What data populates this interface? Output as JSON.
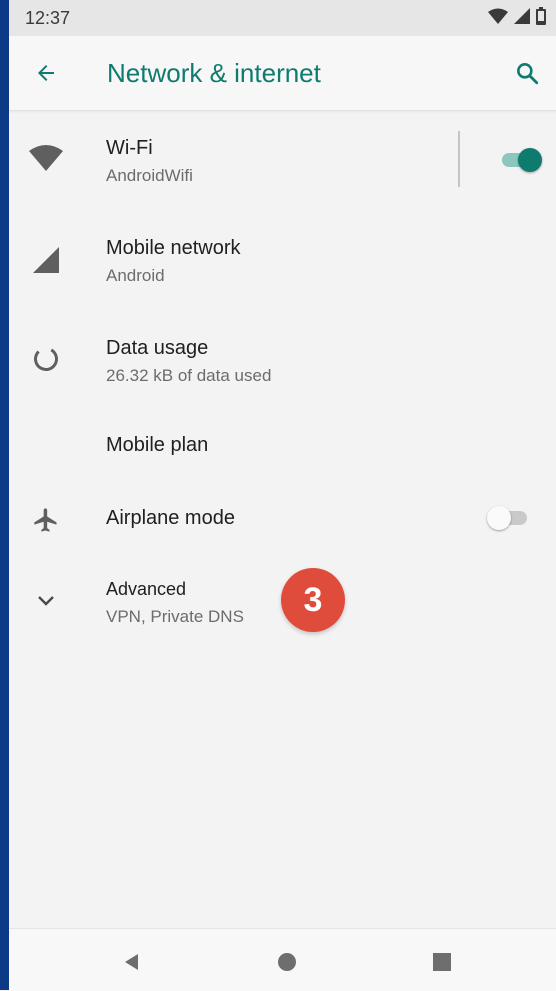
{
  "status_bar": {
    "time": "12:37",
    "icons": [
      "wifi-icon",
      "signal-icon",
      "battery-icon"
    ]
  },
  "app_bar": {
    "title": "Network & internet",
    "back_icon": "arrow-back-icon",
    "search_icon": "search-icon"
  },
  "colors": {
    "accent": "#0f7b6f",
    "badge": "#e04c3c",
    "left_stripe": "#0c3a86"
  },
  "settings": [
    {
      "icon": "wifi-icon",
      "title": "Wi-Fi",
      "subtitle": "AndroidWifi",
      "toggle": true,
      "toggle_on": true
    },
    {
      "icon": "mobile-signal-icon",
      "title": "Mobile network",
      "subtitle": "Android"
    },
    {
      "icon": "data-usage-icon",
      "title": "Data usage",
      "subtitle": "26.32 kB of data used"
    },
    {
      "icon": "",
      "title": "Mobile plan",
      "subtitle": ""
    },
    {
      "icon": "airplane-icon",
      "title": "Airplane mode",
      "subtitle": "",
      "toggle": true,
      "toggle_on": false
    },
    {
      "icon": "chevron-down-icon",
      "title": "Advanced",
      "subtitle": "VPN, Private DNS"
    }
  ],
  "annotation": {
    "step_number": "3"
  },
  "nav_bar": {
    "icons": [
      "back-triangle-icon",
      "home-circle-icon",
      "recents-square-icon"
    ]
  }
}
